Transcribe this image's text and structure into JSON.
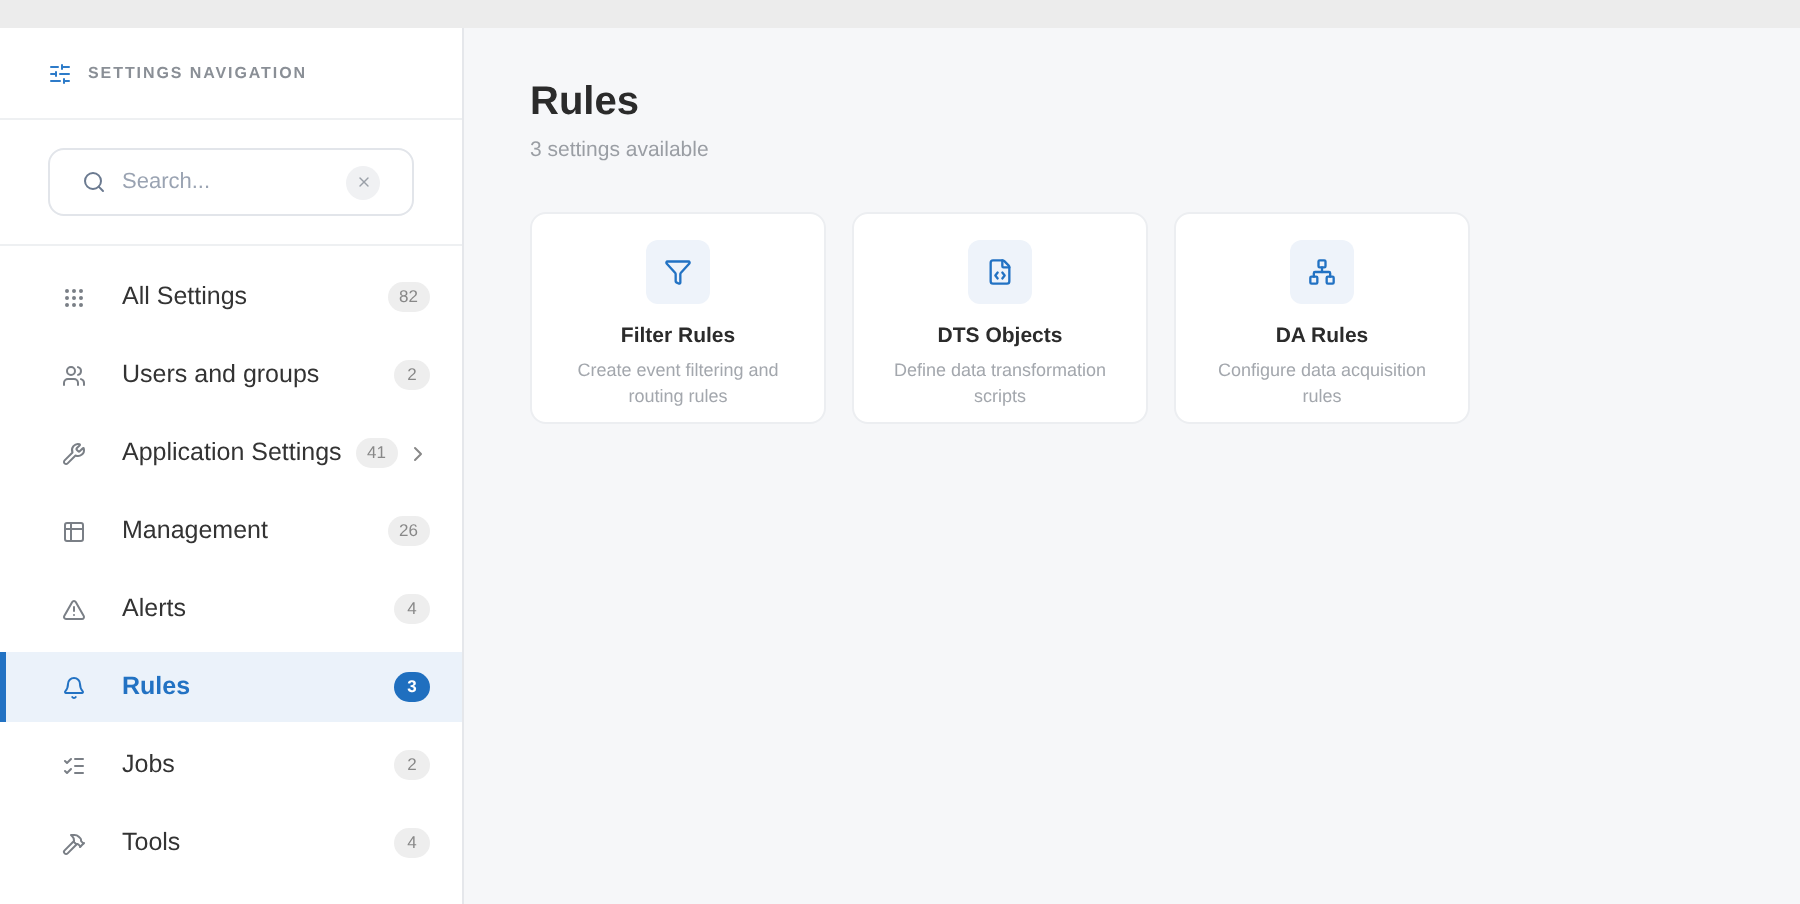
{
  "sidebar": {
    "title": "SETTINGS NAVIGATION",
    "search": {
      "placeholder": "Search..."
    },
    "items": [
      {
        "label": "All Settings",
        "count": "82",
        "selected": false,
        "expandable": false
      },
      {
        "label": "Users and groups",
        "count": "2",
        "selected": false,
        "expandable": false
      },
      {
        "label": "Application Settings",
        "count": "41",
        "selected": false,
        "expandable": true
      },
      {
        "label": "Management",
        "count": "26",
        "selected": false,
        "expandable": false
      },
      {
        "label": "Alerts",
        "count": "4",
        "selected": false,
        "expandable": false
      },
      {
        "label": "Rules",
        "count": "3",
        "selected": true,
        "expandable": false
      },
      {
        "label": "Jobs",
        "count": "2",
        "selected": false,
        "expandable": false
      },
      {
        "label": "Tools",
        "count": "4",
        "selected": false,
        "expandable": false
      }
    ]
  },
  "main": {
    "title": "Rules",
    "subtitle": "3 settings available",
    "cards": [
      {
        "title": "Filter Rules",
        "description": "Create event filtering and routing rules"
      },
      {
        "title": "DTS Objects",
        "description": "Define data transformation scripts"
      },
      {
        "title": "DA Rules",
        "description": "Configure data acquisition rules"
      }
    ]
  }
}
